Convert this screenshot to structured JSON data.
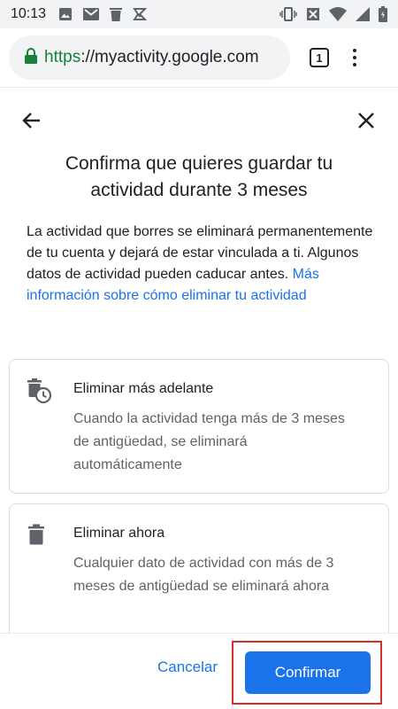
{
  "status_bar": {
    "time": "10:13",
    "icons_left": [
      "image-icon",
      "gmail-icon",
      "trash-icon",
      "hub-icon"
    ],
    "icons_right": [
      "vibrate-icon",
      "no-signal-icon",
      "wifi-icon",
      "signal-icon",
      "battery-icon"
    ]
  },
  "browser": {
    "url_scheme": "https",
    "url_rest": "://myactivity.google.com",
    "tab_count": "1"
  },
  "dialog": {
    "title": "Confirma que quieres guardar tu actividad durante 3 meses",
    "description": "La actividad que borres se eliminará permanentemente de tu cuenta y dejará de estar vinculada a ti. Algunos datos de actividad pueden caducar antes.",
    "link_text": "Más información sobre cómo eliminar tu actividad",
    "options": [
      {
        "title": "Eliminar más adelante",
        "body": "Cuando la actividad tenga más de 3 meses de antigüedad, se eliminará automáticamente",
        "icon": "delete-clock-icon"
      },
      {
        "title": "Eliminar ahora",
        "body": "Cualquier dato de actividad con más de 3 meses de antigüedad se eliminará ahora",
        "icon": "delete-icon"
      }
    ],
    "cancel_label": "Cancelar",
    "confirm_label": "Confirmar"
  },
  "colors": {
    "accent": "#1a73e8",
    "highlight": "#d93025",
    "secure": "#188038"
  }
}
